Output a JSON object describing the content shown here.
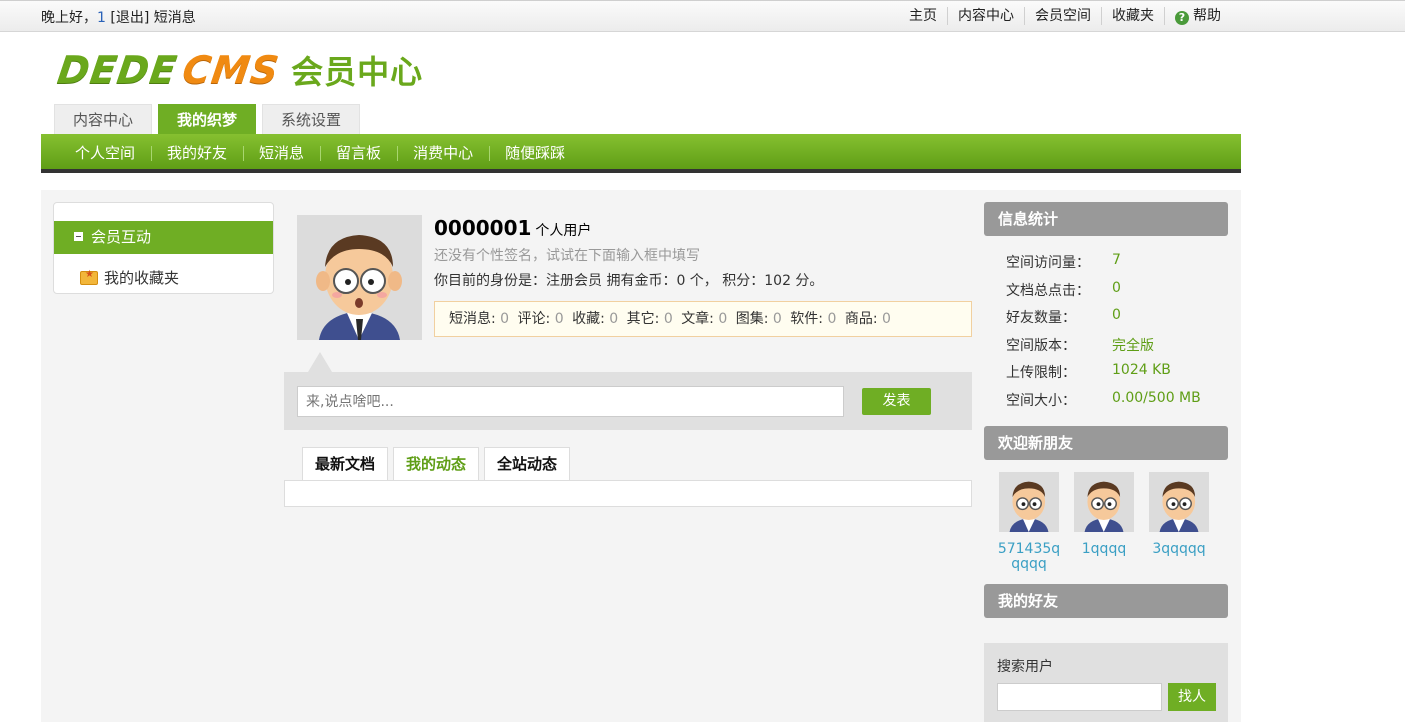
{
  "topbar": {
    "greeting": "晚上好，",
    "msg_count": "1",
    "logout": "[退出]",
    "messages": "短消息",
    "links": [
      "主页",
      "内容中心",
      "会员空间",
      "收藏夹"
    ],
    "help": "帮助"
  },
  "logo": {
    "brand_left": "DEDE",
    "brand_right": "CMS",
    "title": "会员中心"
  },
  "main_tabs": [
    "内容中心",
    "我的织梦",
    "系统设置"
  ],
  "nav": [
    "个人空间",
    "我的好友",
    "短消息",
    "留言板",
    "消费中心",
    "随便踩踩"
  ],
  "sidebar": {
    "group": "会员互动",
    "favorites": "我的收藏夹"
  },
  "profile": {
    "username": "0000001",
    "user_type": "个人用户",
    "signature_hint": "还没有个性签名，试试在下面输入框中填写",
    "identity": "你目前的身份是：注册会员 拥有金币：0 个， 积分：102 分。",
    "stats": [
      {
        "label": "短消息:",
        "value": "0"
      },
      {
        "label": "评论:",
        "value": "0"
      },
      {
        "label": "收藏:",
        "value": "0"
      },
      {
        "label": "其它:",
        "value": "0"
      },
      {
        "label": "文章:",
        "value": "0"
      },
      {
        "label": "图集:",
        "value": "0"
      },
      {
        "label": "软件:",
        "value": "0"
      },
      {
        "label": "商品:",
        "value": "0"
      }
    ]
  },
  "post": {
    "placeholder": "来,说点啥吧...",
    "button": "发表"
  },
  "feed_tabs": [
    "最新文档",
    "我的动态",
    "全站动态"
  ],
  "info": {
    "title": "信息统计",
    "rows": [
      {
        "key": "空间访问量：",
        "value": "7"
      },
      {
        "key": "文档总点击：",
        "value": "0"
      },
      {
        "key": "好友数量：",
        "value": "0"
      },
      {
        "key": "空间版本：",
        "value": "完全版"
      },
      {
        "key": "上传限制：",
        "value": "1024 KB"
      },
      {
        "key": "空间大小：",
        "value": "0.00/500 MB"
      }
    ]
  },
  "new_friends": {
    "title": "欢迎新朋友",
    "users": [
      "571435qqqqq",
      "1qqqq",
      "3qqqqq"
    ]
  },
  "my_friends": {
    "title": "我的好友"
  },
  "search": {
    "label": "搜索用户",
    "button": "找人"
  },
  "colors": {
    "brand_green": "#6fae24",
    "accent_orange": "#f08a12",
    "link_blue": "#3a9fc4"
  }
}
